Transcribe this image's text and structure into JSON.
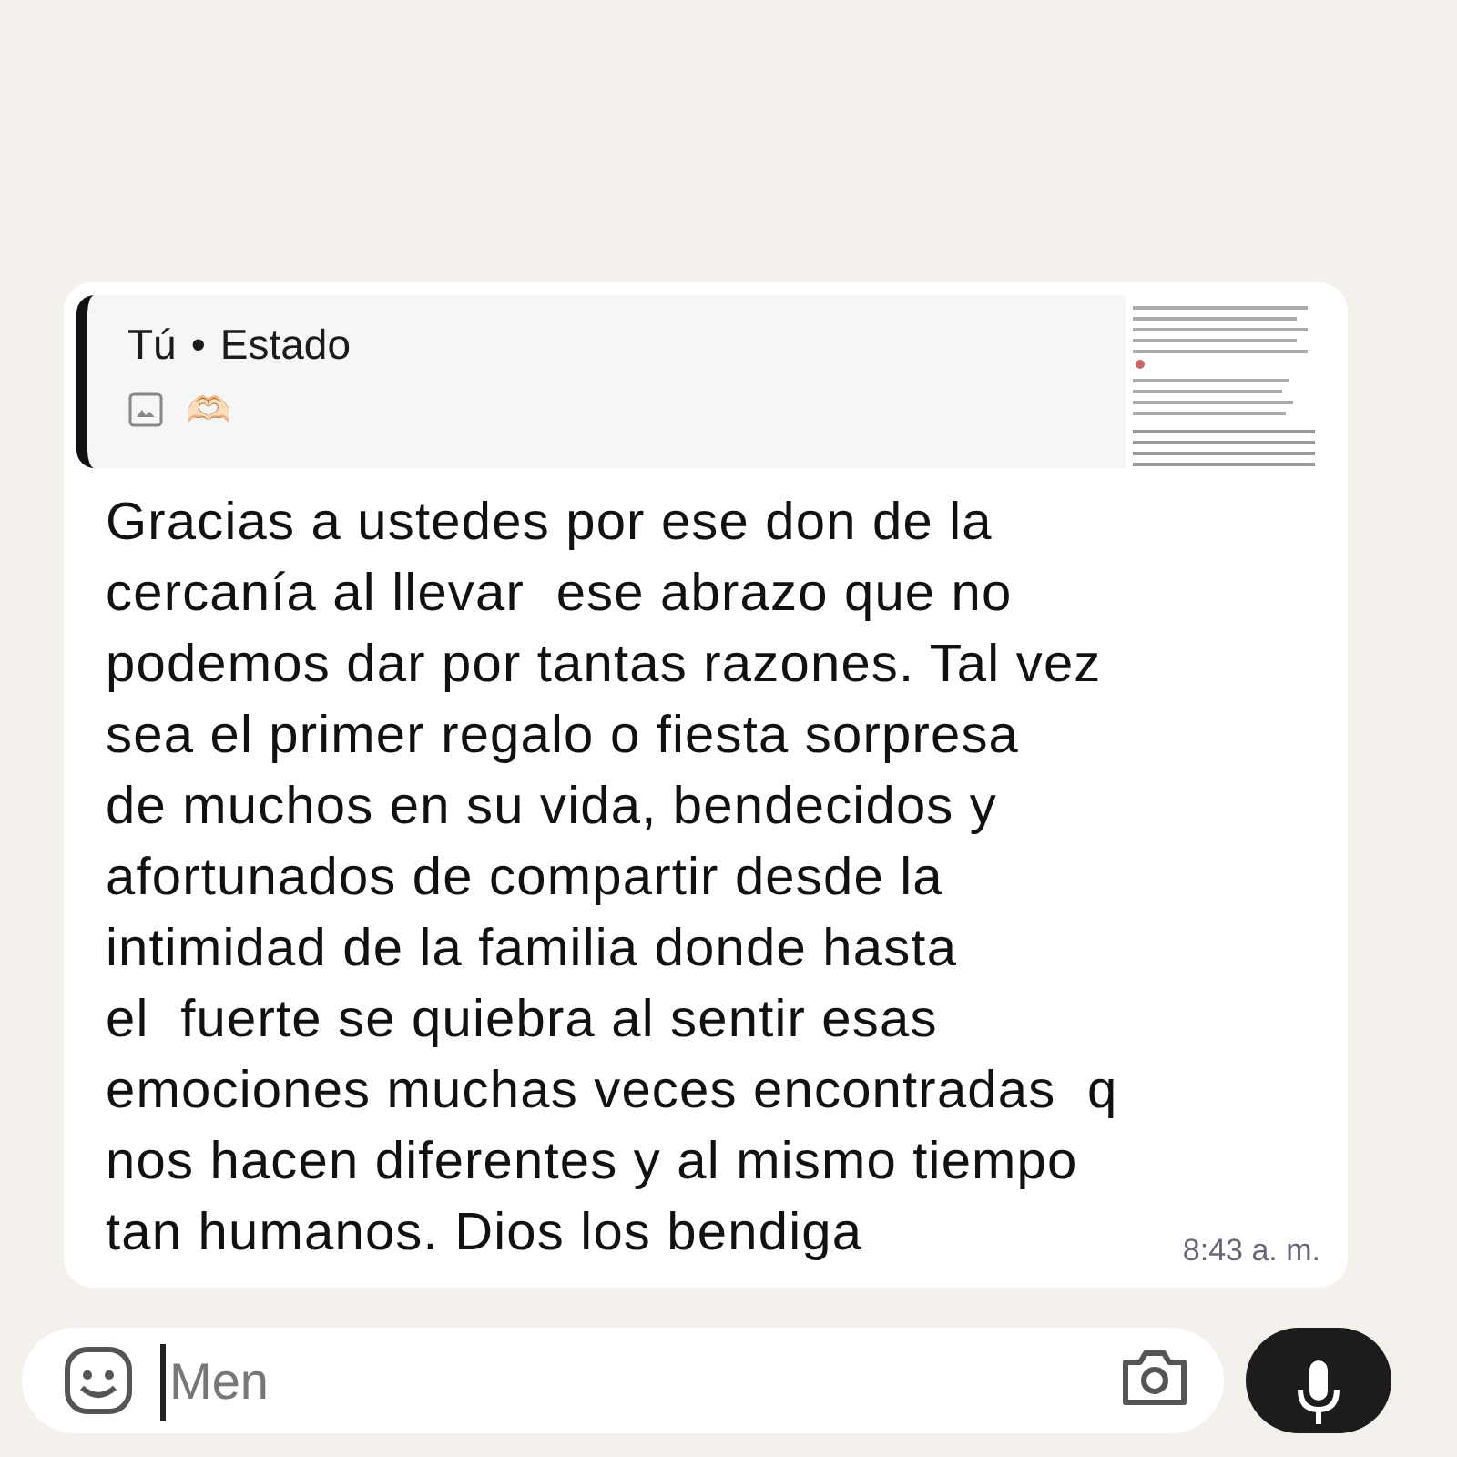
{
  "message": {
    "quote": {
      "author": "Tú",
      "separator": "•",
      "source": "Estado",
      "emoji": "🫶🏻",
      "kind": "picture"
    },
    "text": "Gracias a ustedes por ese don de la\ncercanía al llevar  ese abrazo que no\npodemos dar por tantas razones. Tal vez\nsea el primer regalo o fiesta sorpresa\nde muchos en su vida, bendecidos y\nafortunados de compartir desde la\nintimidad de la familia donde hasta\nel  fuerte se quiebra al sentir esas\nemociones muchas veces encontradas  q\nnos hacen diferentes y al mismo tiempo\ntan humanos. Dios los bendiga",
    "time": "8:43 a. m."
  },
  "composer": {
    "placeholder": "Men"
  }
}
